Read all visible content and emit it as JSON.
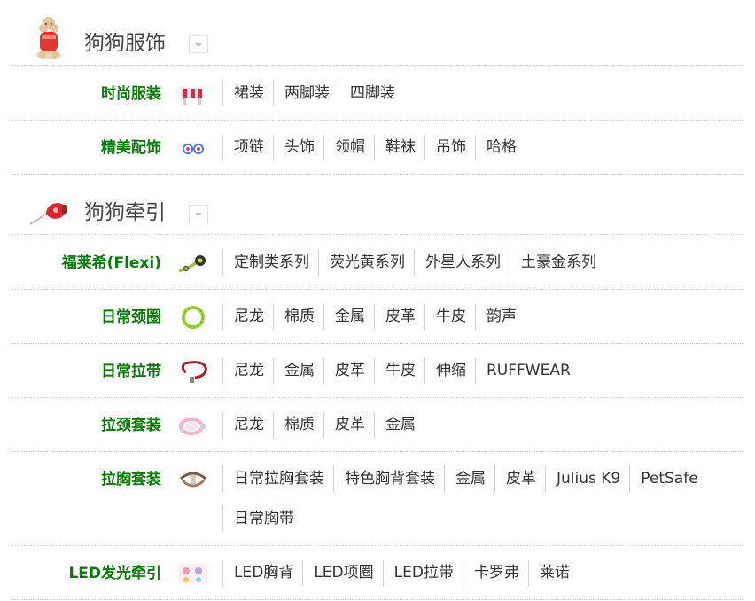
{
  "sections": [
    {
      "title": "狗狗服饰",
      "icon": "poodle-icon",
      "rows": [
        {
          "label": "时尚服装",
          "thumb": "dog-sweater-icon",
          "links": [
            "裙装",
            "两脚装",
            "四脚装"
          ]
        },
        {
          "label": "精美配饰",
          "thumb": "accessory-icon",
          "links": [
            "项链",
            "头饰",
            "领帽",
            "鞋袜",
            "吊饰",
            "哈格"
          ]
        }
      ]
    },
    {
      "title": "狗狗牵引",
      "icon": "retractable-leash-icon",
      "rows": [
        {
          "label": "福莱希(Flexi)",
          "thumb": "flexi-leash-icon",
          "links": [
            "定制类系列",
            "荧光黄系列",
            "外星人系列",
            "土豪金系列"
          ]
        },
        {
          "label": "日常颈圈",
          "thumb": "collar-icon",
          "links": [
            "尼龙",
            "棉质",
            "金属",
            "皮革",
            "牛皮",
            "韵声"
          ]
        },
        {
          "label": "日常拉带",
          "thumb": "leash-icon",
          "links": [
            "尼龙",
            "金属",
            "皮革",
            "牛皮",
            "伸缩",
            "RUFFWEAR"
          ]
        },
        {
          "label": "拉颈套装",
          "thumb": "collar-set-icon",
          "links": [
            "尼龙",
            "棉质",
            "皮革",
            "金属"
          ]
        },
        {
          "label": "拉胸套装",
          "thumb": "harness-icon",
          "links": [
            "日常拉胸套装",
            "特色胸背套装",
            "金属",
            "皮革",
            "Julius K9",
            "PetSafe",
            "日常胸带"
          ]
        },
        {
          "label": "LED发光牵引",
          "thumb": "led-leash-icon",
          "links": [
            "LED胸背",
            "LED项圈",
            "LED拉带",
            "卡罗弗",
            "莱诺"
          ]
        }
      ]
    }
  ]
}
